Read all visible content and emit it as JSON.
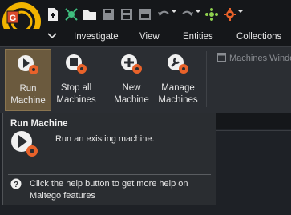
{
  "menu": {
    "items": [
      "Investigate",
      "View",
      "Entities",
      "Collections"
    ]
  },
  "toolbar": {
    "icons": [
      "new-icon",
      "transform-icon",
      "open-folder-icon",
      "save-icon",
      "save-as-icon",
      "abc-icon",
      "undo-icon",
      "redo-icon",
      "hub-icon",
      "run-machine-icon"
    ]
  },
  "ribbon": {
    "buttons": [
      {
        "label_line1": "Run",
        "label_line2": "Machine",
        "icon": "run-machine-icon",
        "active": true
      },
      {
        "label_line1": "Stop all",
        "label_line2": "Machines",
        "icon": "stop-machines-icon",
        "active": false
      },
      {
        "label_line1": "New",
        "label_line2": "Machine",
        "icon": "new-machine-icon",
        "active": false
      },
      {
        "label_line1": "Manage",
        "label_line2": "Machines",
        "icon": "manage-machines-icon",
        "active": false
      }
    ],
    "machines_window_label": "Machines Windo"
  },
  "tooltip": {
    "title": "Run Machine",
    "description": "Run an existing machine.",
    "help_text": "Click the help button to get more help on Maltego features"
  },
  "colors": {
    "accent": "#6b5a3e",
    "gear_orange": "#e8622a",
    "logo_yellow": "#f2b400"
  }
}
